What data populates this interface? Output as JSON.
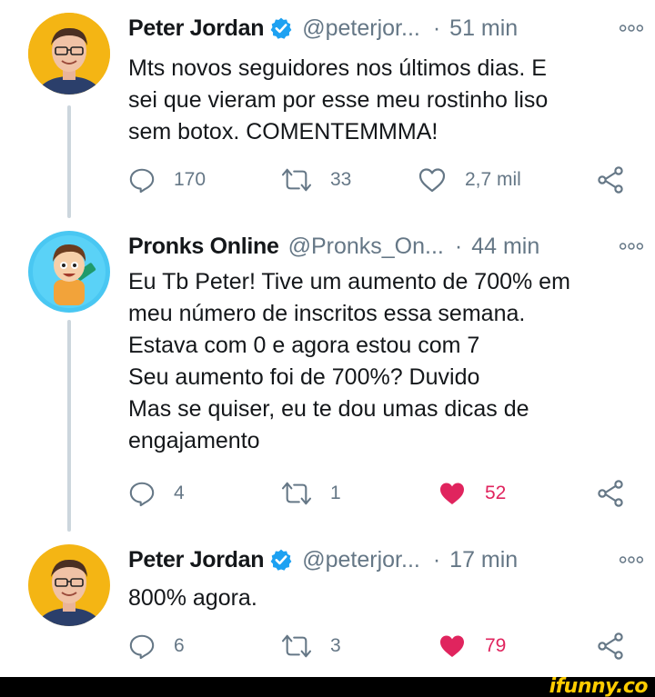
{
  "colors": {
    "verified_badge": "#1da1f2",
    "secondary_text": "#657786",
    "like_active": "#e0245e",
    "thread_line": "#ccd6dd",
    "watermark": "#ffcc00"
  },
  "tweets": [
    {
      "author": "Peter Jordan",
      "verified": true,
      "handle": "@peterjor...",
      "separator": "·",
      "time": "51 min",
      "text": "Mts novos seguidores nos últimos dias. E\nsei que vieram por esse meu rostinho liso\nsem botox. COMENTEMMMA!",
      "replies": "170",
      "retweets": "33",
      "likes": "2,7 mil",
      "liked": false
    },
    {
      "author": "Pronks Online",
      "verified": false,
      "handle": "@Pronks_On...",
      "separator": "·",
      "time": "44 min",
      "text": "Eu Tb Peter! Tive um aumento de 700% em\nmeu número de inscritos essa semana.\nEstava com 0 e agora estou com 7\nSeu aumento foi de 700%? Duvido\nMas se quiser, eu te dou umas dicas de\nengajamento",
      "replies": "4",
      "retweets": "1",
      "likes": "52",
      "liked": true
    },
    {
      "author": "Peter Jordan",
      "verified": true,
      "handle": "@peterjor...",
      "separator": "·",
      "time": "17 min",
      "text": "800% agora.",
      "replies": "6",
      "retweets": "3",
      "likes": "79",
      "liked": true
    }
  ],
  "icons": {
    "reply": "reply-icon",
    "retweet": "retweet-icon",
    "like": "heart-icon",
    "share": "share-icon",
    "more": "more-options-icon",
    "verified": "verified-badge-icon"
  },
  "watermark": "ifunny.co"
}
